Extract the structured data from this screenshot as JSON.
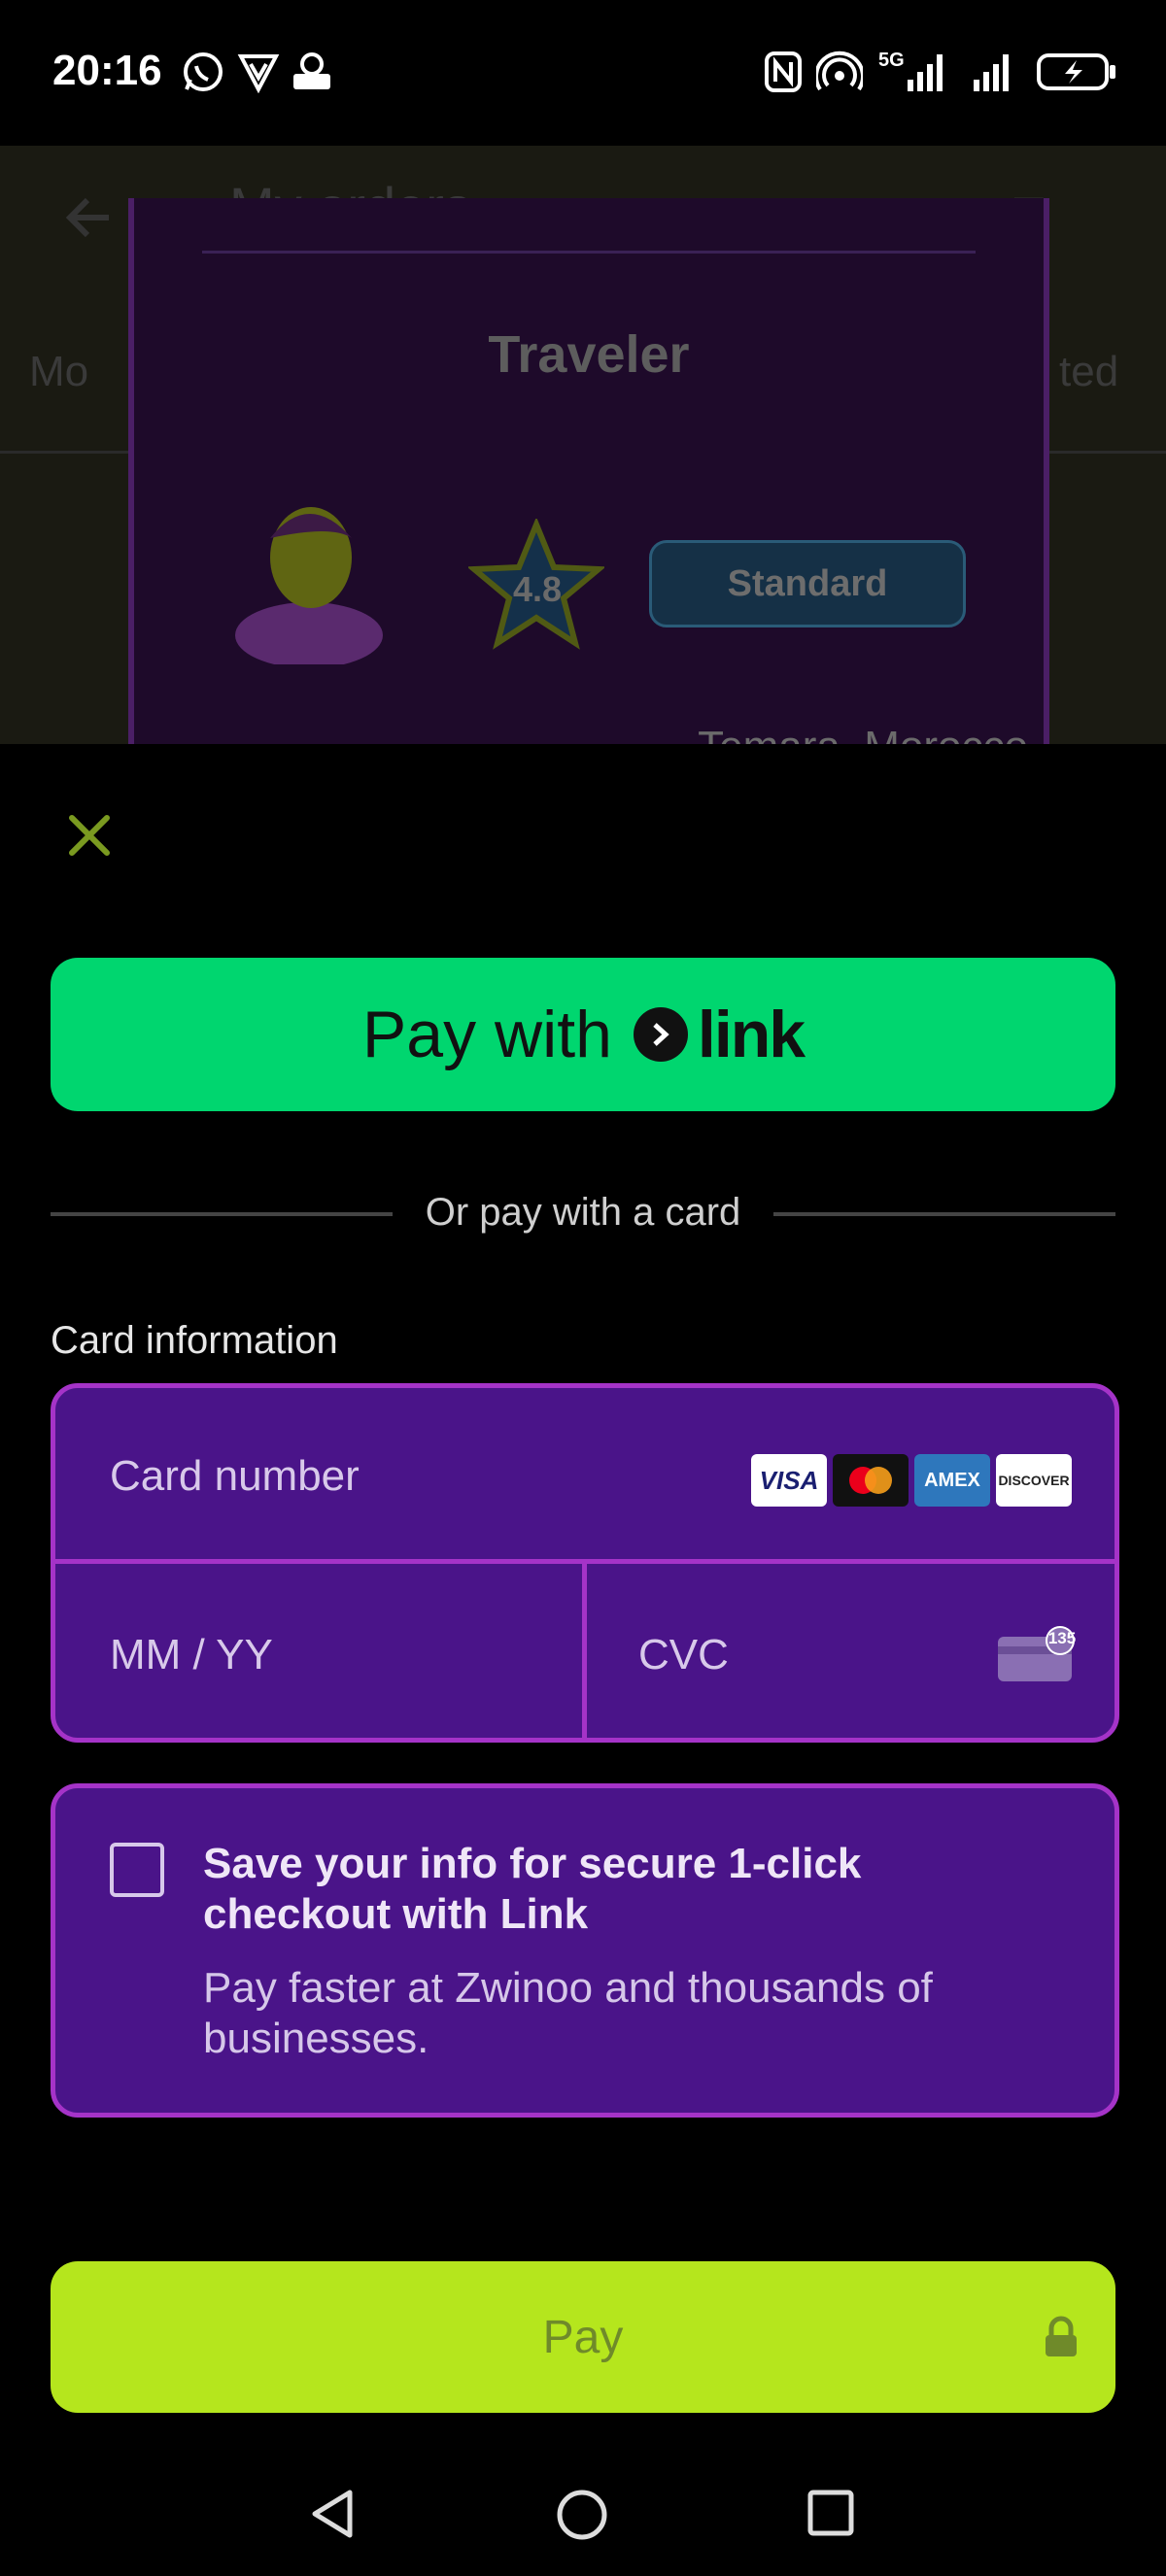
{
  "status_bar": {
    "time": "20:16",
    "network_label": "5G"
  },
  "background_app": {
    "title": "My orders",
    "tab_left": "Mo",
    "tab_right": "ted",
    "role": "Traveler",
    "rating": "4.8",
    "tier": "Standard",
    "location": "Temara, Morocco"
  },
  "payment_sheet": {
    "link_button": {
      "prefix": "Pay with",
      "brand": "link"
    },
    "divider_text": "Or pay with a card",
    "card_info_label": "Card information",
    "card_number_placeholder": "Card number",
    "expiry_placeholder": "MM / YY",
    "cvc_placeholder": "CVC",
    "cvc_hint_number": "135",
    "card_brands": [
      "VISA",
      "mastercard",
      "AMEX",
      "DISCOVER"
    ],
    "save_info_title": "Save your info for secure 1-click checkout with Link",
    "save_info_subtitle": "Pay faster at Zwinoo and thousands of businesses.",
    "pay_button": "Pay",
    "colors": {
      "link_green": "#00d66f",
      "field_purple": "#4a1489",
      "field_border": "#a533c8",
      "pay_lime": "#b5e61d"
    }
  },
  "nav_bar": {
    "back": "back-icon",
    "home": "home-icon",
    "recents": "recents-icon"
  }
}
